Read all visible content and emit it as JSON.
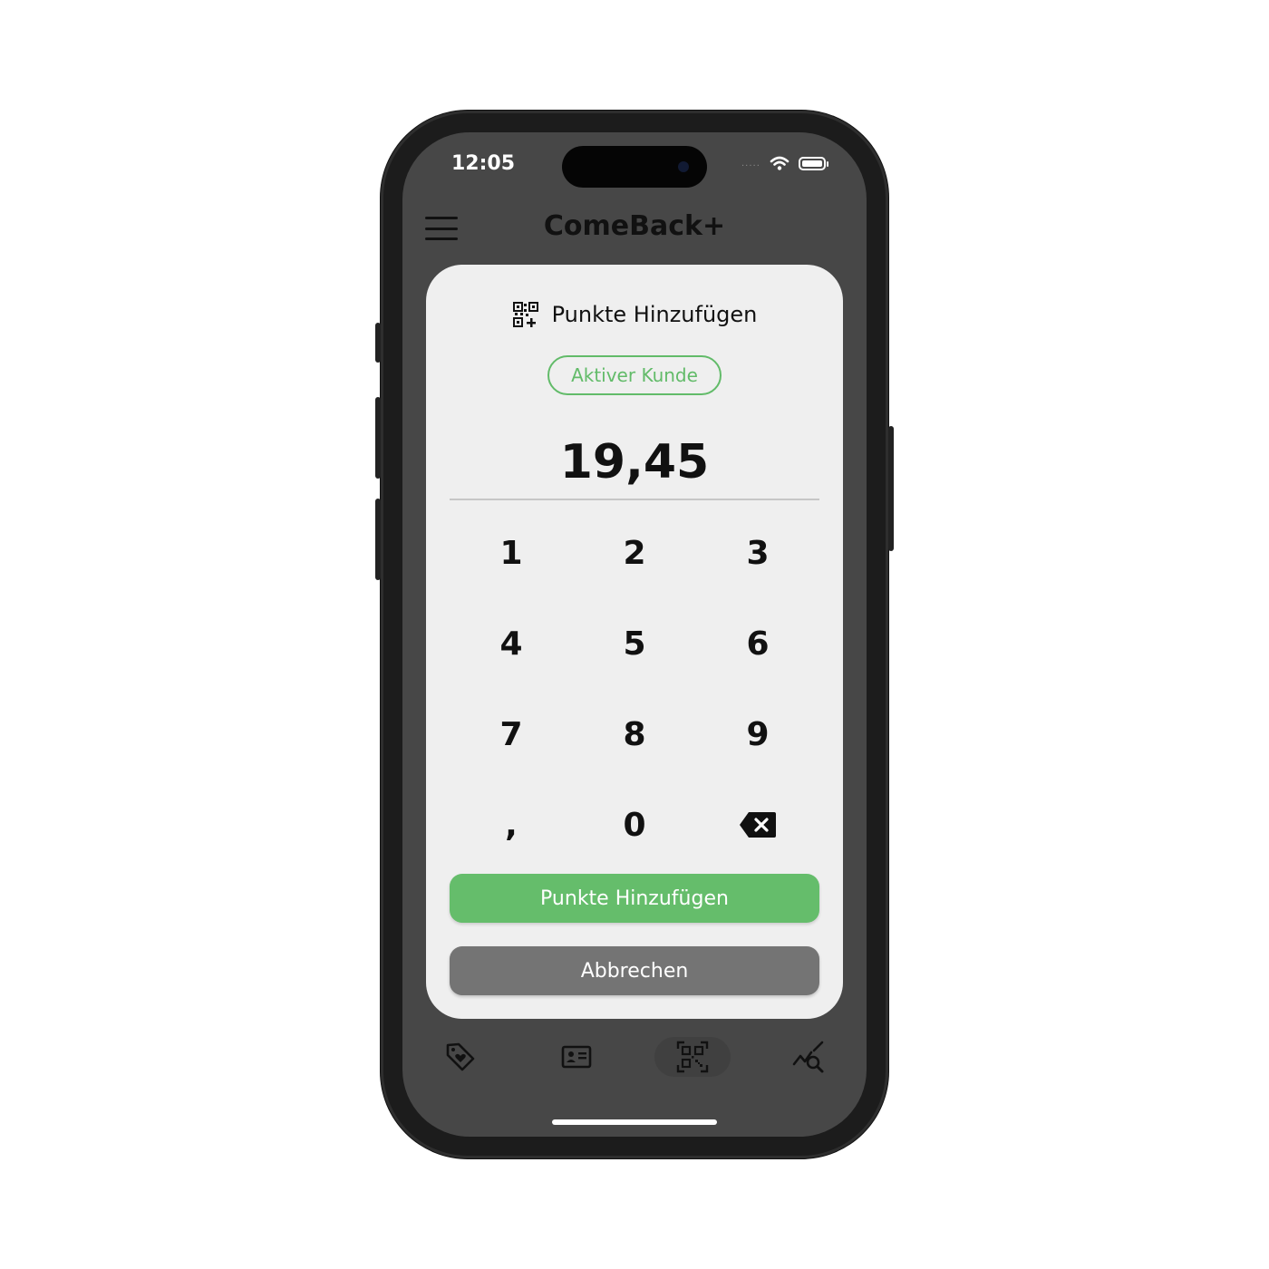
{
  "status_bar": {
    "time": "12:05",
    "signal": "....."
  },
  "header": {
    "title": "ComeBack+",
    "menu_icon": "hamburger-menu-icon"
  },
  "dialog": {
    "title": "Punkte Hinzufügen",
    "title_icon": "qr-code-plus-icon",
    "status_badge": "Aktiver Kunde",
    "amount": "19,45",
    "keypad": [
      "1",
      "2",
      "3",
      "4",
      "5",
      "6",
      "7",
      "8",
      "9",
      ",",
      "0"
    ],
    "delete_icon": "backspace-icon",
    "primary_button": "Punkte Hinzufügen",
    "cancel_button": "Abbrechen"
  },
  "tab_bar": [
    {
      "icon": "tag-heart-icon",
      "active": false
    },
    {
      "icon": "id-card-icon",
      "active": false
    },
    {
      "icon": "qr-scan-icon",
      "active": true
    },
    {
      "icon": "analytics-search-icon",
      "active": false
    }
  ],
  "colors": {
    "accent": "#65bd6b",
    "screen_bg": "#474747",
    "card_bg": "#efefef",
    "cancel": "#747474"
  }
}
